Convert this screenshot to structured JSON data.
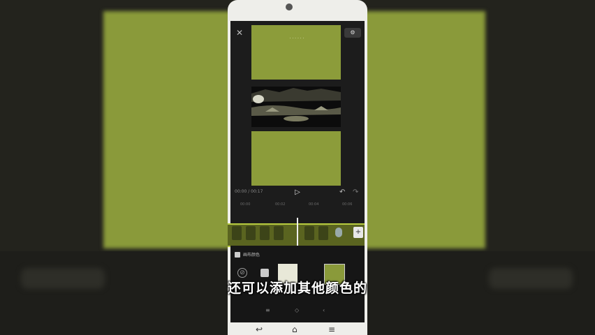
{
  "editor": {
    "close_icon": "close-icon",
    "export_label": "⚙",
    "video_title": "· · · · · ·",
    "timecode": "00:00 / 00:17",
    "play_icon": "play-icon",
    "undo_icon": "undo-icon",
    "redo_icon": "redo-icon",
    "ruler_marks": [
      "00:00",
      "00:02",
      "00:04",
      "00:06"
    ],
    "add_clip_label": "+"
  },
  "panel": {
    "title": "画布颜色",
    "none_label": "⊘",
    "tools": [
      "≡",
      "◇",
      "‹"
    ]
  },
  "subtitle": "还可以添加其他颜色的",
  "colors": {
    "canvas_green": "#8c9c3a",
    "track_border": "#b8cc40",
    "subtitle": "#ffffff"
  }
}
